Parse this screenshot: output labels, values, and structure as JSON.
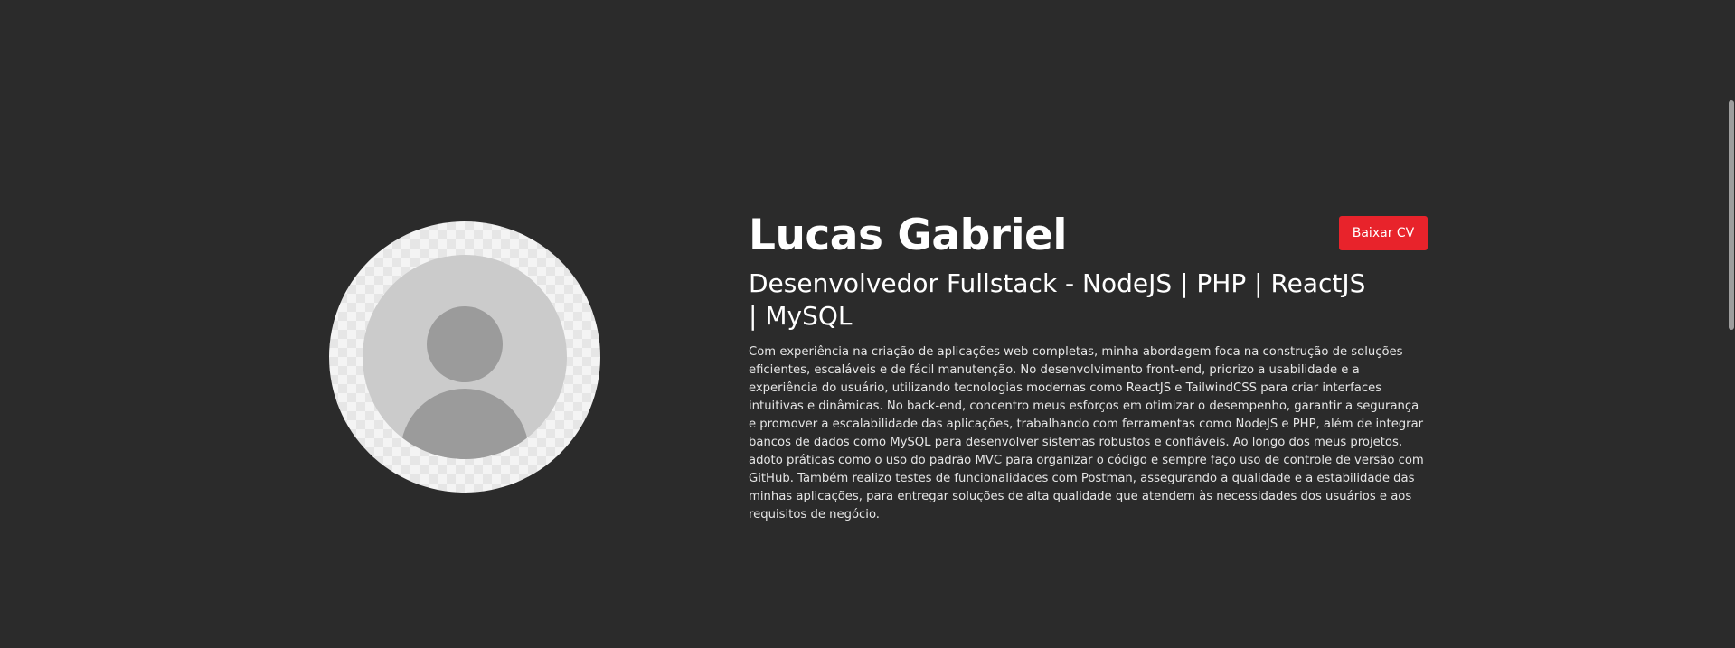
{
  "profile": {
    "name": "Lucas Gabriel",
    "title": "Desenvolvedor Fullstack - NodeJS | PHP | ReactJS | MySQL",
    "bio": "Com experiência na criação de aplicações web completas, minha abordagem foca na construção de soluções eficientes, escaláveis e de fácil manutenção. No desenvolvimento front-end, priorizo a usabilidade e a experiência do usuário, utilizando tecnologias modernas como ReactJS e TailwindCSS para criar interfaces intuitivas e dinâmicas. No back-end, concentro meus esforços em otimizar o desempenho, garantir a segurança e promover a escalabilidade das aplicações, trabalhando com ferramentas como NodeJS e PHP, além de integrar bancos de dados como MySQL para desenvolver sistemas robustos e confiáveis. Ao longo dos meus projetos, adoto práticas como o uso do padrão MVC para organizar o código e sempre faço uso de controle de versão com GitHub. Também realizo testes de funcionalidades com Postman, assegurando a qualidade e a estabilidade das minhas aplicações, para entregar soluções de alta qualidade que atendem às necessidades dos usuários e aos requisitos de negócio.",
    "avatar_icon": "user-placeholder-icon"
  },
  "actions": {
    "download_cv_label": "Baixar CV"
  },
  "colors": {
    "background": "#2b2b2b",
    "accent": "#e8232b",
    "text": "#ffffff"
  }
}
